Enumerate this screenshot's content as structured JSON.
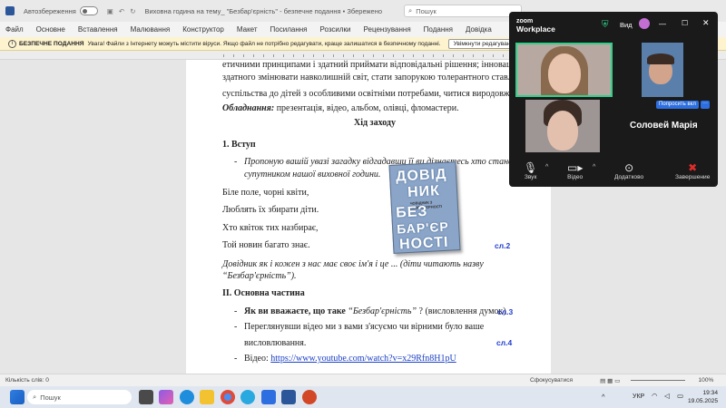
{
  "word": {
    "autosave_label": "Автозбереження",
    "doc_title": "Виховна година на тему_ \"Безбар'єрність\" - безпечне подання • Збережено",
    "search_placeholder": "Пошук",
    "menu": [
      "Файл",
      "Основне",
      "Вставлення",
      "Малювання",
      "Конструктор",
      "Макет",
      "Посилання",
      "Розсилки",
      "Рецензування",
      "Подання",
      "Довідка"
    ],
    "security": {
      "title": "БЕЗПЕЧНЕ ПОДАННЯ",
      "message": "Увага! Файли з Інтернету можуть містити віруси. Якщо файл не потрібно редагувати, краще залишатися в безпечному поданні.",
      "enable_button": "Увімкнути редагування"
    },
    "status": {
      "word_count": "Кількість слів: 0",
      "focus": "Сфокусуватися",
      "zoom": "100%"
    }
  },
  "document": {
    "line1": "етичними принципами і здатний приймати відповідальні рішення; інноваційн",
    "line2": "здатного змінювати навколишній світ, стати запорукою толерантного ставлен",
    "line3": "суспільства до дітей з особливими освітніми потребами, читися виродовж жит",
    "equipment_label": "Обладнання:",
    "equipment_text": "презентація, відео, альбом, олівці, фломастери.",
    "heading": "Хід заходу",
    "section1": "1. Вступ",
    "riddle_intro_1": "Пропоную вашій увазі загадку відгадавши її ви дізнаєтесь хто стане",
    "riddle_intro_2": "супутником нашої виховної години.",
    "riddle": [
      "Біле поле, чорні квіти,",
      "Люблять їх збирати діти.",
      "Хто квіток тих назбирає,",
      "Той новин багато знає."
    ],
    "slide2": "сл.2",
    "note_1": "Довідник як і кожен з нас має своє ім'я і це ... (діти читають назву",
    "note_2": "“Безбар'єрність”).",
    "section2": "II. Основна частина",
    "q1_bold": "Як ви вважаєте, що таке",
    "q1_italic": "“Безбар'єрність”",
    "q1_rest": "? (висловлення думок)",
    "slide3": "сл.3",
    "q2_1": "Переглянувши відео ми з вами з'ясуємо чи вірними було ваше",
    "q2_2": "висловлювання.",
    "slide4": "сл.4",
    "video_label": "Відео:",
    "video_url": "https://www.youtube.com/watch?v=x29Rfn8H1pU",
    "dash": "-"
  },
  "book": {
    "lines": [
      "ДОВІД",
      "НИК",
      "БЕЗ",
      "БАР'ЄР",
      "НОСТІ"
    ],
    "small_text": "ЧОВІДНИК З БЕЗБАР'ЄРНОСТІ"
  },
  "zoom": {
    "logo_top": "zoom",
    "logo_bottom": "Workplace",
    "view_label": "Вид",
    "ask_button": "Попросить вкл",
    "participant_name": "Соловей Марія",
    "buttons": {
      "sound": "Звук",
      "video": "Відео",
      "more": "Додатково",
      "end": "Завершение"
    },
    "colors": {
      "active_border": "#2fd18a",
      "end": "#e02b2b",
      "ask": "#2d6fe0"
    }
  },
  "taskbar": {
    "search_placeholder": "Пошук",
    "lang": "УКР",
    "time": "19:34",
    "date": "19.05.2025"
  }
}
